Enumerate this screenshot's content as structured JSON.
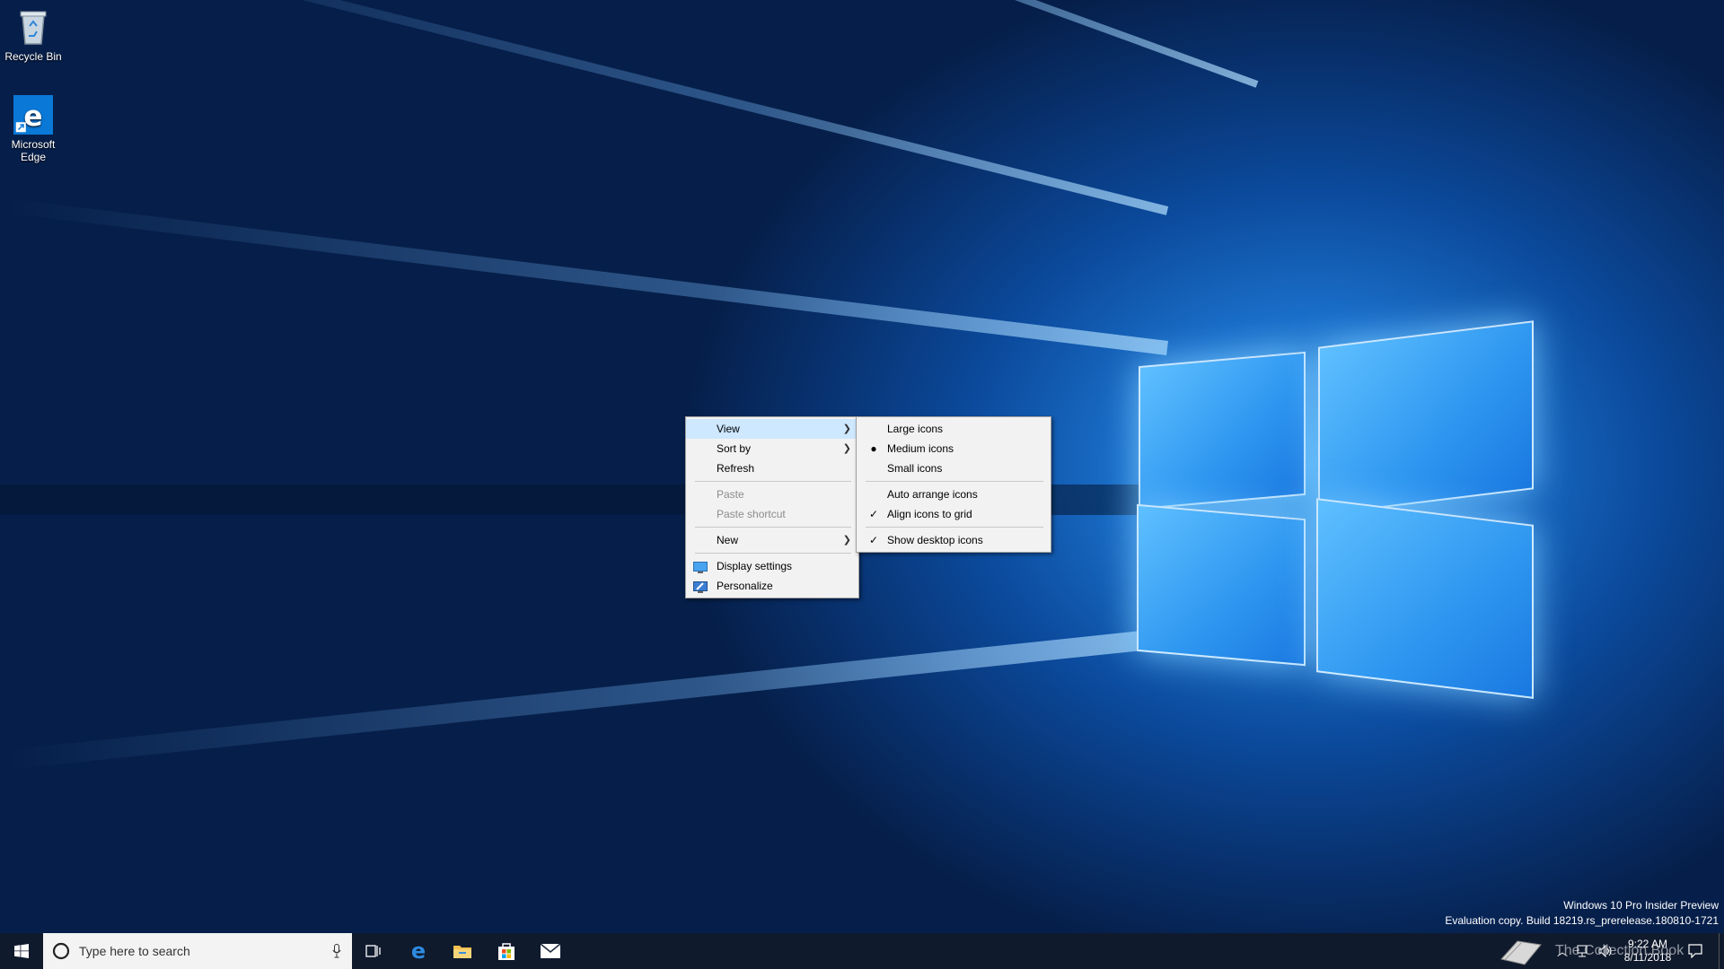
{
  "desktop": {
    "icons": [
      {
        "label": "Recycle Bin"
      },
      {
        "label": "Microsoft Edge"
      }
    ]
  },
  "context_menu": {
    "items": [
      {
        "label": "View"
      },
      {
        "label": "Sort by"
      },
      {
        "label": "Refresh"
      },
      {
        "label": "Paste"
      },
      {
        "label": "Paste shortcut"
      },
      {
        "label": "New"
      },
      {
        "label": "Display settings"
      },
      {
        "label": "Personalize"
      }
    ]
  },
  "view_submenu": {
    "items": [
      {
        "label": "Large icons"
      },
      {
        "label": "Medium icons",
        "selected": true
      },
      {
        "label": "Small icons"
      },
      {
        "label": "Auto arrange icons"
      },
      {
        "label": "Align icons to grid",
        "checked": true
      },
      {
        "label": "Show desktop icons",
        "checked": true
      }
    ]
  },
  "taskbar": {
    "search_placeholder": "Type here to search",
    "pinned": [
      "task-view",
      "edge",
      "file-explorer",
      "store",
      "mail"
    ],
    "clock": {
      "time": "9:22 AM",
      "date": "8/11/2018"
    }
  },
  "watermark": {
    "line1": "Windows 10 Pro Insider Preview",
    "line2": "Evaluation copy. Build 18219.rs_prerelease.180810-1721"
  },
  "overlay_logo": {
    "text": "The Collection Book"
  },
  "colors": {
    "menu_bg": "#f2f2f2",
    "highlight": "#cde8ff",
    "taskbar": "#101a2c",
    "accent": "#0078d7"
  }
}
